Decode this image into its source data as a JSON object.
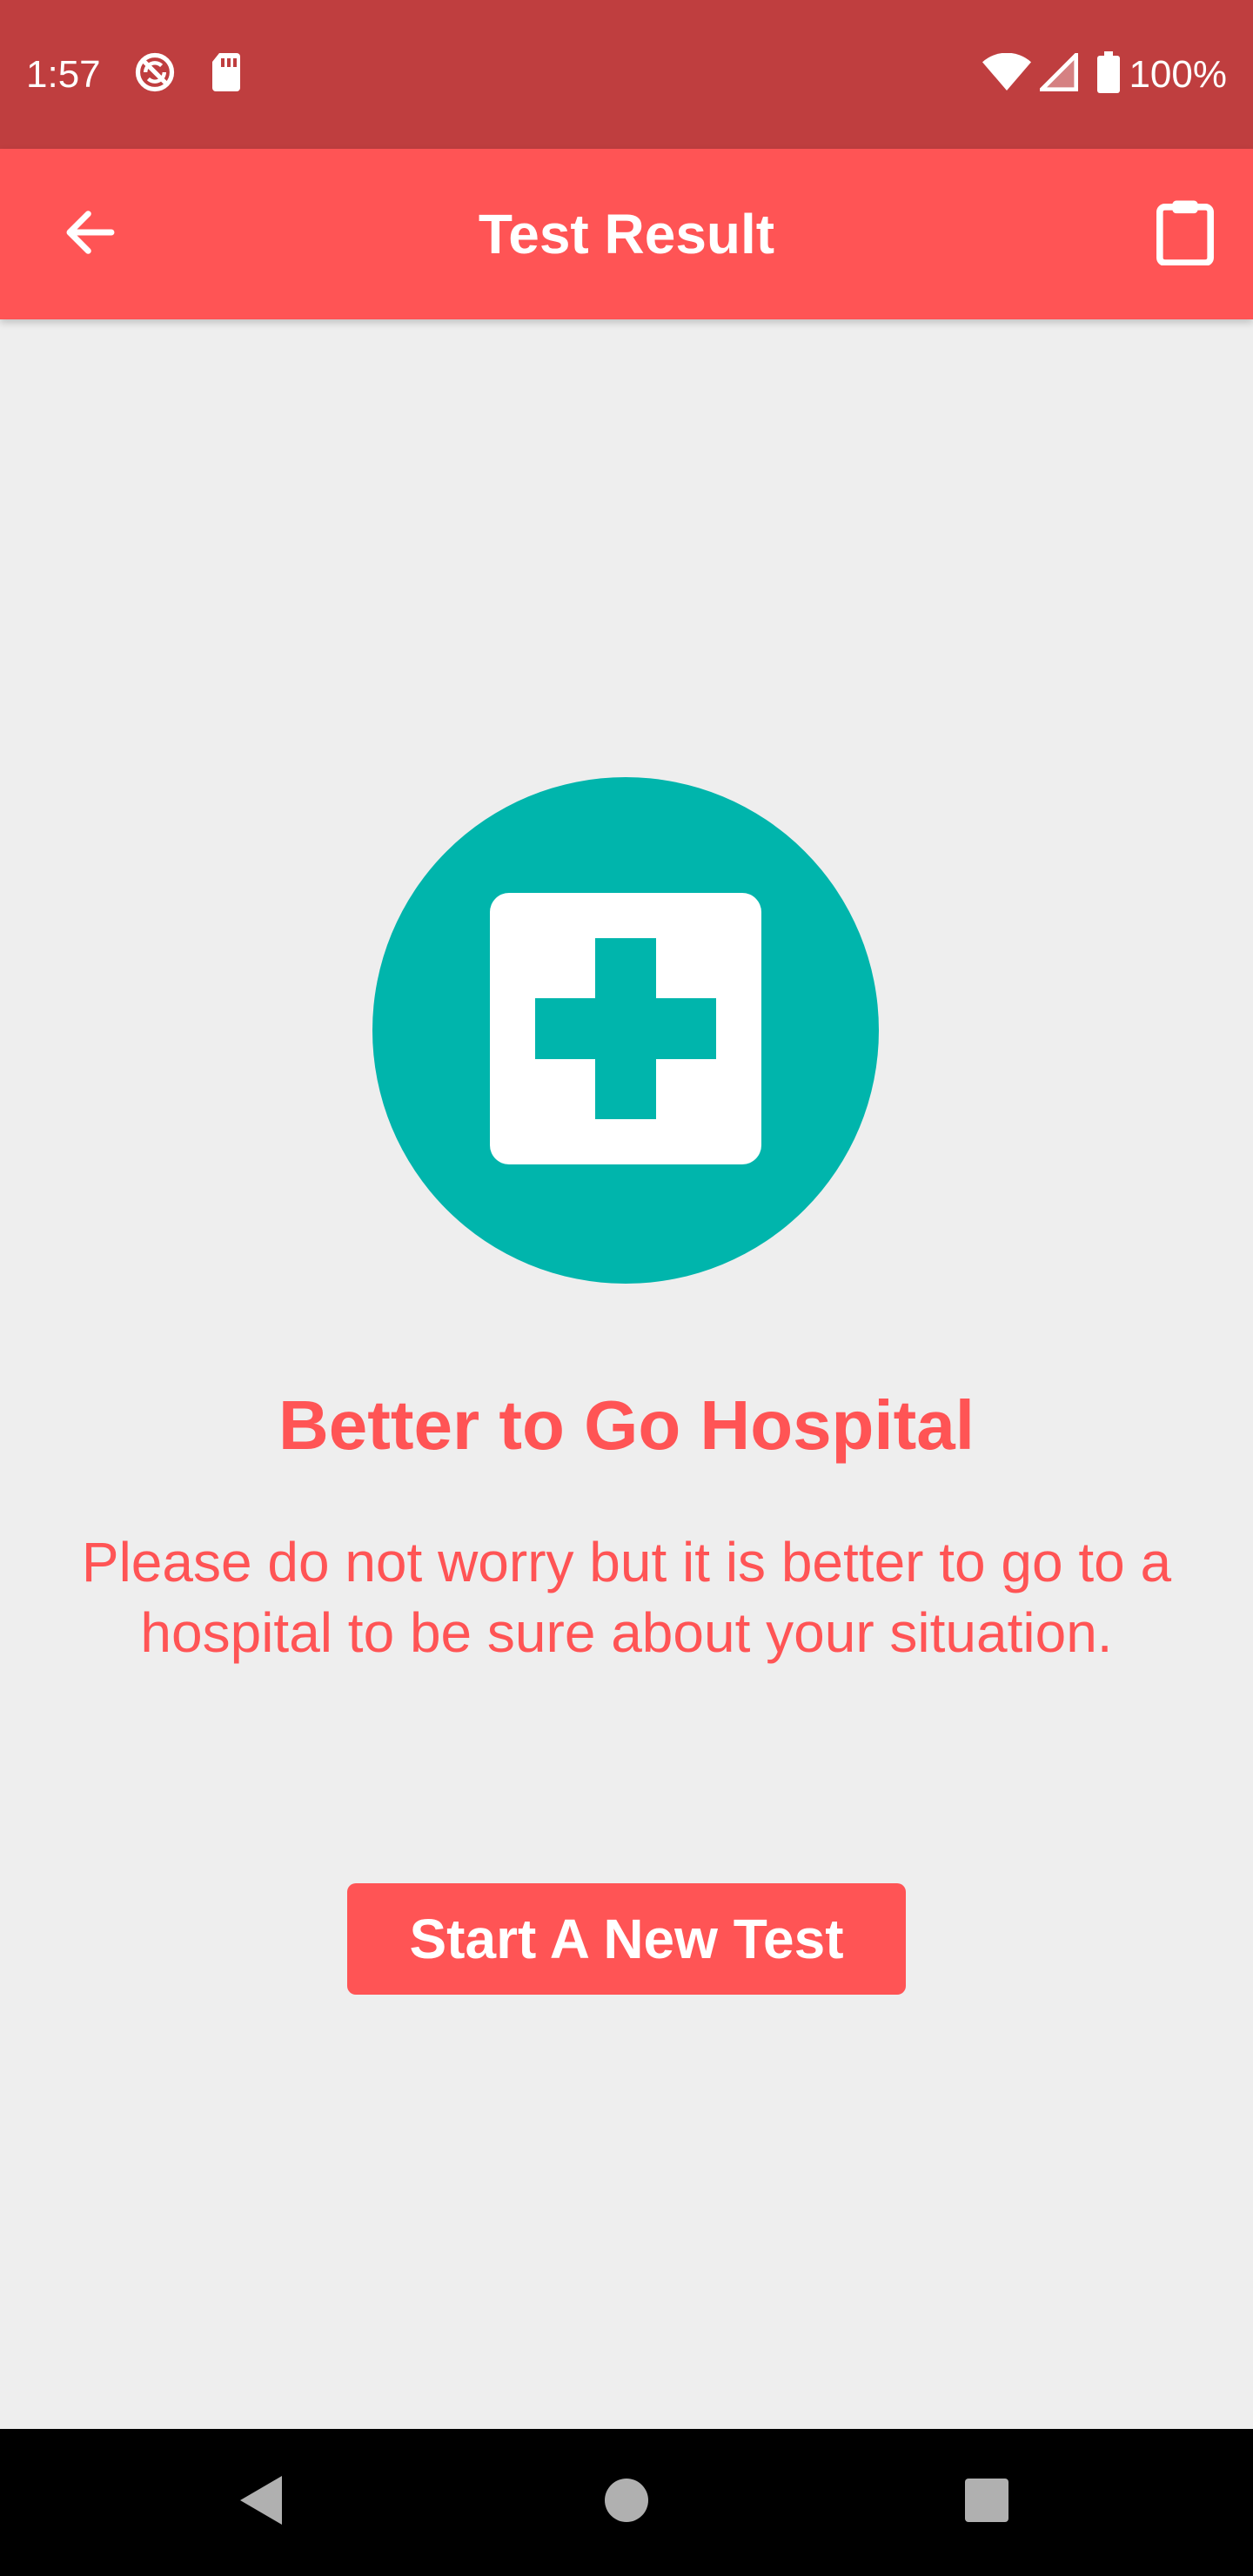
{
  "status_bar": {
    "time": "1:57",
    "battery_pct": "100%",
    "icons": [
      "sync-off-icon",
      "sd-card-icon",
      "wifi-icon",
      "cell-signal-icon",
      "battery-icon"
    ]
  },
  "app_bar": {
    "title": "Test Result",
    "back_icon": "arrow-back-icon",
    "action_icon": "clipboard-icon"
  },
  "result": {
    "icon": "hospital-cross-icon",
    "title": "Better to Go Hospital",
    "message": "Please do not worry but it is better to go to a hospital to be sure about your situation.",
    "button_label": "Start A New Test"
  },
  "nav_bar": {
    "icons": [
      "back-triangle-icon",
      "home-circle-icon",
      "recents-square-icon"
    ]
  },
  "colors": {
    "status_bar": "#bf3e3f",
    "accent": "#ff5455",
    "badge": "#00b5ac",
    "background": "#eeeeee"
  }
}
